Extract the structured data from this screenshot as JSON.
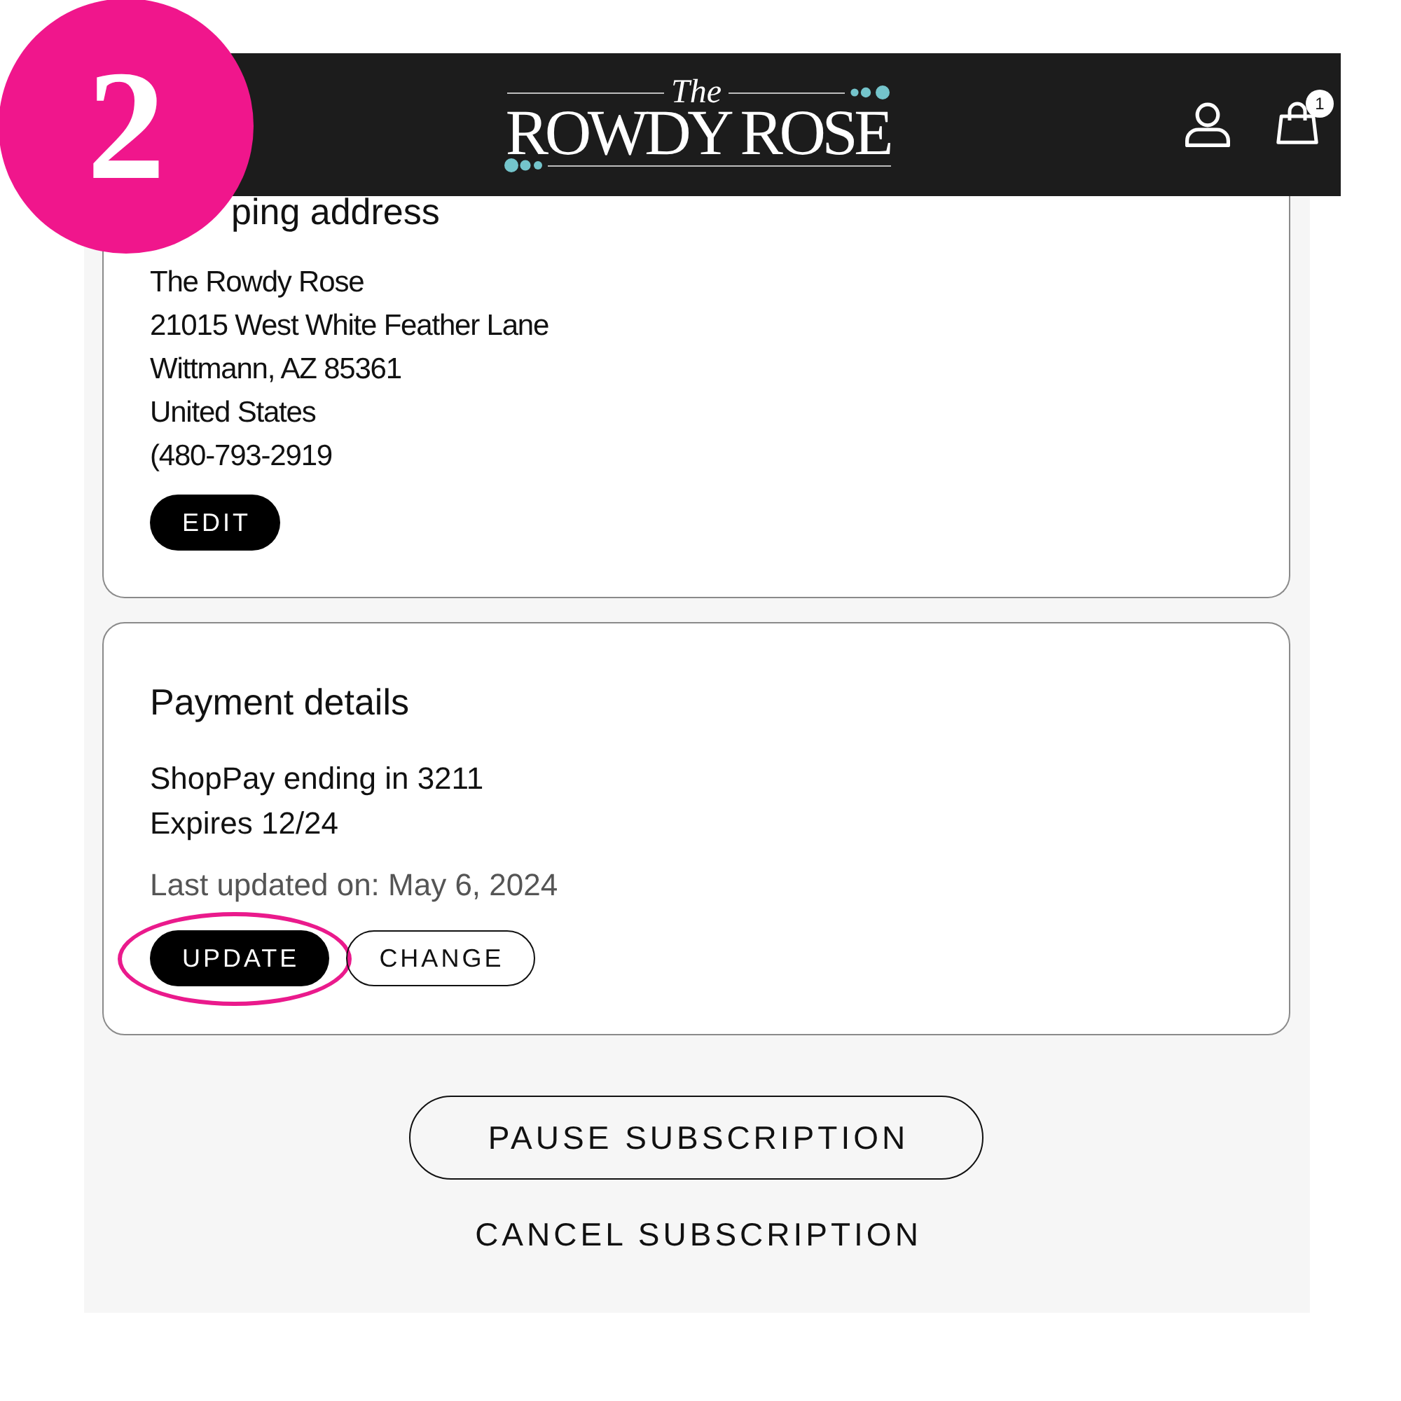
{
  "step_badge": {
    "label": "2"
  },
  "header": {
    "logo": {
      "script": "The",
      "wordmark": "ROWDY ROSE"
    },
    "cart_count": "1"
  },
  "shipping_address": {
    "title": "ping address",
    "lines": [
      "The Rowdy Rose",
      "21015 West White Feather Lane",
      "Wittmann, AZ 85361",
      "United States",
      "(480-793-2919"
    ],
    "buttons": [
      {
        "label": "EDIT",
        "kind": "primary",
        "highlighted": false
      }
    ]
  },
  "payment_details": {
    "title": "Payment details",
    "lines": [
      "ShopPay ending in 3211",
      "Expires 12/24"
    ],
    "note": "Last updated on: May 6, 2024",
    "buttons": [
      {
        "label": "UPDATE",
        "kind": "primary",
        "highlighted": true
      },
      {
        "label": "CHANGE",
        "kind": "outline",
        "highlighted": false
      }
    ]
  },
  "subscription_actions": [
    {
      "label": "PAUSE SUBSCRIPTION",
      "kind": "outline"
    },
    {
      "label": "CANCEL SUBSCRIPTION",
      "kind": "text"
    }
  ]
}
